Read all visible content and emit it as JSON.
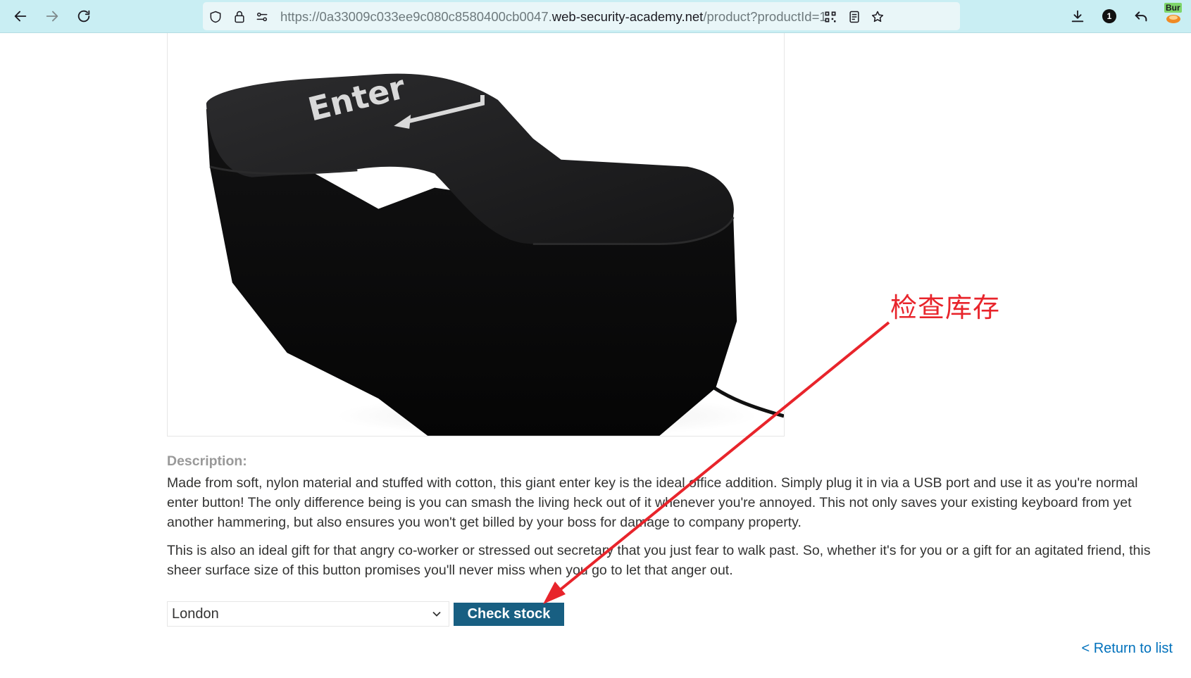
{
  "browser": {
    "url_prefix": "https://0a33009c033ee9c080c8580400cb0047.",
    "url_host": "web-security-academy.net",
    "url_path": "/product?productId=1",
    "notification_count": "1",
    "burp_label": "Bur"
  },
  "product": {
    "image_key_text": "Enter",
    "description_heading": "Description:",
    "description_p1": "Made from soft, nylon material and stuffed with cotton, this giant enter key is the ideal office addition. Simply plug it in via a USB port and use it as you're normal enter button! The only difference being is you can smash the living heck out of it whenever you're annoyed. This not only saves your existing keyboard from yet another hammering, but also ensures you won't get billed by your boss for damage to company property.",
    "description_p2": "This is also an ideal gift for that angry co-worker or stressed out secretary that you just fear to walk past. So, whether it's for you or a gift for an agitated friend, this sheer surface size of this button promises you'll never miss when you go to let that anger out."
  },
  "stock": {
    "selected_store": "London",
    "check_button_label": "Check stock"
  },
  "nav": {
    "return_link": "< Return to list"
  },
  "annotation": {
    "label": "检查库存",
    "color": "#e8242b"
  },
  "colors": {
    "toolbar_bg": "#c9eef3",
    "button_bg": "#185f82",
    "link": "#0071bc"
  }
}
